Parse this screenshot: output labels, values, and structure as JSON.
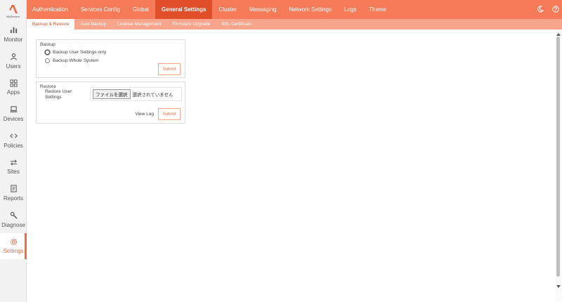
{
  "brand": {
    "name": "MySecure",
    "accent": "#f26b45"
  },
  "sidebar": {
    "items": [
      {
        "label": "Monitor",
        "icon": "bar-chart-icon"
      },
      {
        "label": "Users",
        "icon": "user-icon"
      },
      {
        "label": "Apps",
        "icon": "apps-icon"
      },
      {
        "label": "Devices",
        "icon": "laptop-icon"
      },
      {
        "label": "Policies",
        "icon": "code-arrows-icon"
      },
      {
        "label": "Sites",
        "icon": "swap-arrows-icon"
      },
      {
        "label": "Reports",
        "icon": "report-icon"
      },
      {
        "label": "Diagnose",
        "icon": "wrench-icon"
      },
      {
        "label": "Settings",
        "icon": "gear-icon",
        "active": true
      }
    ]
  },
  "topnav": {
    "tabs": [
      {
        "label": "Authentication"
      },
      {
        "label": "Services Config"
      },
      {
        "label": "Global"
      },
      {
        "label": "General Settings",
        "active": true
      },
      {
        "label": "Cluster"
      },
      {
        "label": "Messaging"
      },
      {
        "label": "Network Settings"
      },
      {
        "label": "Logs"
      },
      {
        "label": "Theme"
      }
    ]
  },
  "subnav": {
    "tabs": [
      {
        "label": "Backup & Restore",
        "active": true
      },
      {
        "label": "Auto Backup"
      },
      {
        "label": "License Management"
      },
      {
        "label": "Firmware Upgrade"
      },
      {
        "label": "SSL Certificate"
      }
    ]
  },
  "backup": {
    "title": "Backup",
    "option_user": "Backup User Settings only",
    "option_whole": "Backup Whole System",
    "selected": "user",
    "submit": "Submit"
  },
  "restore": {
    "title": "Restore",
    "label": "Restore User Settings",
    "file_button": "ファイルを選択",
    "file_status": "選択されていません",
    "view_log": "View Log",
    "submit": "Submit"
  }
}
